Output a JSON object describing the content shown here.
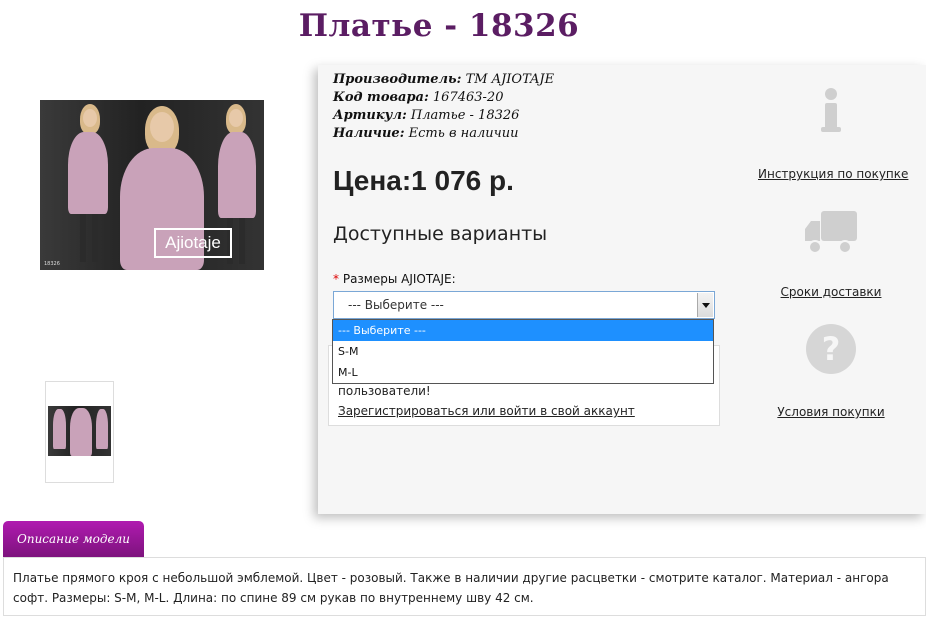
{
  "page_title": "Платье - 18326",
  "image": {
    "brand_mark": "Ajiotaje",
    "code_mark": "18326"
  },
  "product_meta": {
    "manufacturer_label": "Производитель:",
    "manufacturer_value": "ТМ AJIOTAJE",
    "code_label": "Код товара:",
    "code_value": "167463-20",
    "article_label": "Артикул:",
    "article_value": "Платье - 18326",
    "availability_label": "Наличие:",
    "availability_value": "Есть в наличии"
  },
  "price": "Цена:1 076 р.",
  "variants": {
    "heading": "Доступные варианты",
    "required_mark": "*",
    "size_label": "Размеры AJIOTAJE:",
    "selected": "--- Выберите ---",
    "options": [
      "--- Выберите ---",
      "S-M",
      "M-L"
    ]
  },
  "login_notice": {
    "text_tail": "пользователи!",
    "link": "Зарегистрироваться или войти в свой аккаунт"
  },
  "side_links": {
    "instructions": "Инструкция по покупке",
    "delivery": "Сроки доставки",
    "terms": "Условия покупки"
  },
  "tabs": {
    "description_tab": "Описание модели"
  },
  "description": "Платье прямого кроя с небольшой эмблемой. Цвет - розовый. Также в наличии другие расцветки - смотрите каталог. Материал - ангора софт. Размеры: S-M, M-L. Длина: по спине 89 см рукав по внутреннему шву 42 см.",
  "colors": {
    "title": "#5b1d63",
    "tab": "#9b179b",
    "select_highlight": "#1e90ff",
    "icons": "#cfcfcf",
    "dress": "#c9a2b9"
  }
}
